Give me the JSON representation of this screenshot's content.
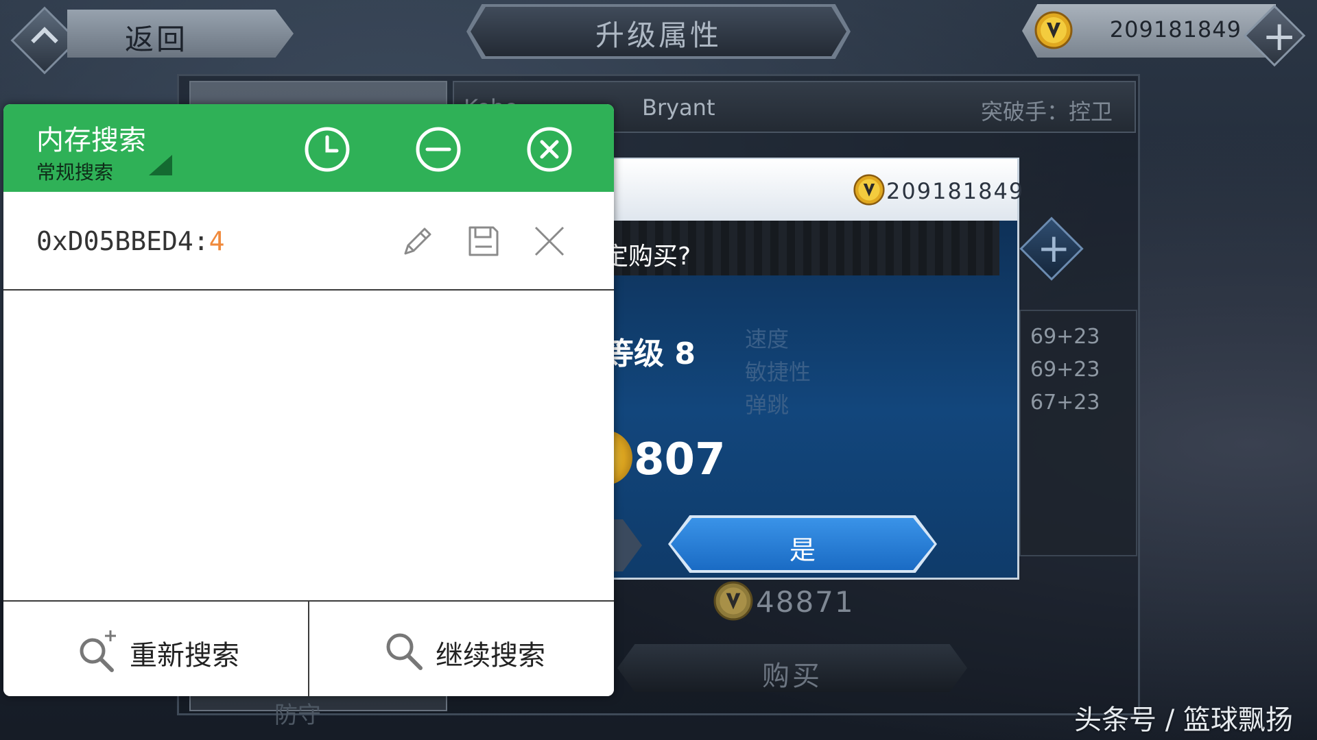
{
  "top_bar": {
    "back_label": "返回",
    "title": "升级属性",
    "coin_balance": "209181849"
  },
  "player": {
    "first_name": "Kobe",
    "last_name": "Bryant",
    "role": "突破手：控卫"
  },
  "stats": [
    "69+23",
    "69+23",
    "67+23"
  ],
  "bottom": {
    "coin_amount": "48871",
    "buy_label": "购买",
    "hidden_label": "防守"
  },
  "dialog": {
    "balance": "209181849",
    "question": "定购买?",
    "level_text": "等级 8",
    "attributes": [
      "速度",
      "敏捷性",
      "弹跳"
    ],
    "cost": "807",
    "confirm_label": "是"
  },
  "memory_search": {
    "title": "内存搜索",
    "mode": "常规搜索",
    "result": {
      "address": "0xD05BBED4:",
      "value": "4"
    },
    "research_label": "重新搜索",
    "continue_label": "继续搜索",
    "icons": [
      "clock-icon",
      "minus-icon",
      "close-icon",
      "pencil-icon",
      "save-icon",
      "remove-icon",
      "search-plus-icon",
      "search-icon"
    ]
  },
  "colors": {
    "overlay_header": "#2fb157",
    "result_value": "#f08a3c",
    "confirm_button": "#1f78d1",
    "dialog_bg": "#12467c"
  },
  "watermark": "头条号 / 篮球飘扬"
}
